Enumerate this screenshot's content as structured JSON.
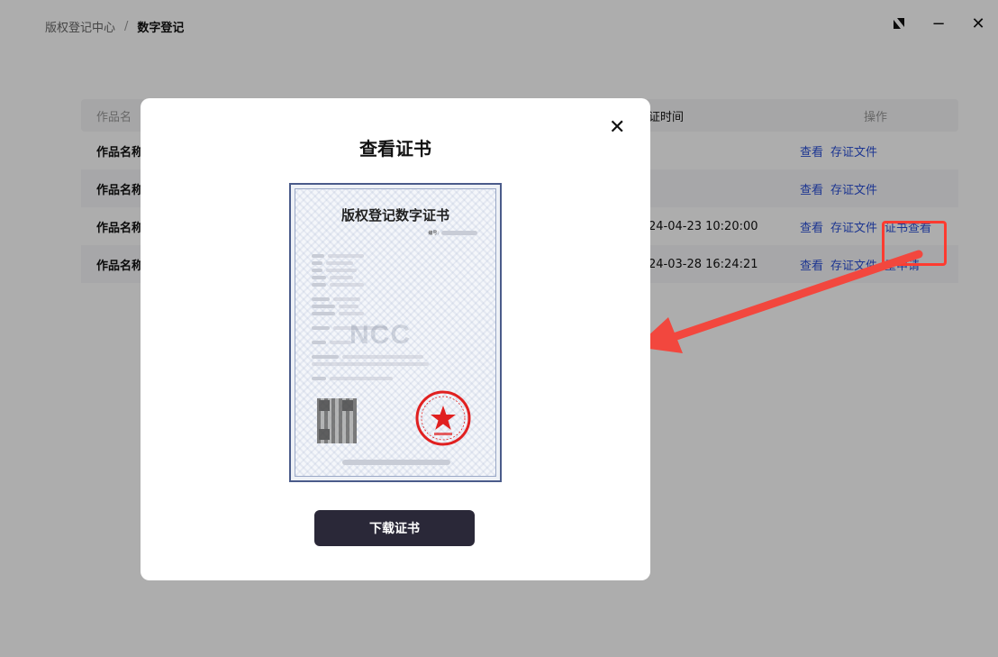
{
  "breadcrumb": {
    "root": "版权登记中心",
    "separator": "/",
    "current": "数字登记"
  },
  "window_controls": {
    "expand": "expand-icon",
    "minimize": "−",
    "close": "✕"
  },
  "table": {
    "headers": {
      "name": "作品名",
      "time": "证时间",
      "ops": "操作"
    },
    "rows": [
      {
        "name": "作品名称",
        "time": "",
        "ops": [
          "查看",
          "存证文件"
        ]
      },
      {
        "name": "作品名称",
        "time": "",
        "ops": [
          "查看",
          "存证文件"
        ]
      },
      {
        "name": "作品名称",
        "time": "24-04-23 10:20:00",
        "ops": [
          "查看",
          "存证文件",
          "证书查看"
        ]
      },
      {
        "name": "作品名称",
        "time": "24-03-28 16:24:21",
        "ops": [
          "查看",
          "存证文件",
          "重申请"
        ]
      }
    ]
  },
  "modal": {
    "title": "查看证书",
    "close": "✕",
    "download": "下载证书",
    "certificate": {
      "title": "版权登记数字证书",
      "number_label": "编号:",
      "watermark": "NCC"
    }
  },
  "colors": {
    "link": "#2a4fd6",
    "highlight": "#ff3b30",
    "arrow": "#f2473e",
    "button": "#2a2838",
    "seal": "#e02020"
  }
}
